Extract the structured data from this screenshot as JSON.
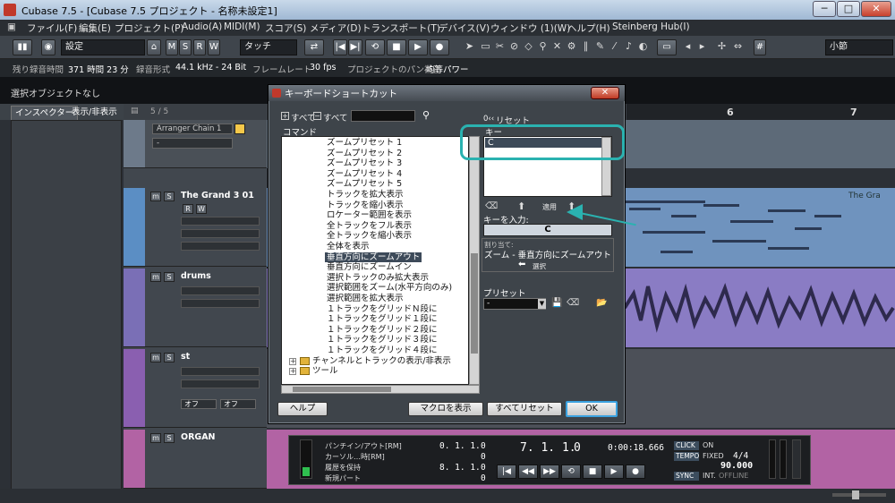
{
  "window": {
    "title": "Cubase 7.5 - [Cubase 7.5 プロジェクト - 名称未設定1]",
    "min_label": "─",
    "max_label": "□",
    "close_label": "✕"
  },
  "menu": {
    "items": [
      "ファイル(F)",
      "編集(E)",
      "プロジェクト(P)",
      "Audio(A)",
      "MIDI(M)",
      "スコア(S)",
      "メディア(D)",
      "トランスポート(T)",
      "デバイス(V)",
      "ウィンドウ (1)(W)",
      "ヘルプ(H)",
      "Steinberg Hub(I)"
    ]
  },
  "toolbar": {
    "preset": "設定",
    "m": "M",
    "s": "S",
    "r": "R",
    "w": "W",
    "mode": "タッチ",
    "snap": "小節"
  },
  "infoline": {
    "rec_time_label": "残り録音時間",
    "rec_time_value": "371 時間 23 分",
    "format_label": "録音形式",
    "format_value": "44.1 kHz - 24 Bit",
    "framerate_label": "フレームレート",
    "framerate_value": "30 fps",
    "pan_label": "プロジェクトのパン補正",
    "pan_value": "均等パワー"
  },
  "selection_line": "選択オブジェクトなし",
  "inspector": {
    "tab_inspector": "インスペクター",
    "tab_view": "表示/非表示",
    "track_count": "5 / 5"
  },
  "tracks": [
    {
      "name": "Arranger Chain 1",
      "extra": "-"
    },
    {
      "name": "The Grand 3 01",
      "clip": "The Gra"
    },
    {
      "name": "drums"
    },
    {
      "name": "st",
      "off1": "オフ",
      "off2": "オフ"
    },
    {
      "name": "ORGAN"
    }
  ],
  "ruler": {
    "bar6": "6",
    "bar7": "7"
  },
  "dialog": {
    "title": "キーボードショートカット",
    "close": "✕",
    "expand_all": "すべて",
    "collapse_all": "すべて",
    "command_header": "コマンド",
    "reset_label": "リセット",
    "key_header": "キー",
    "key_value": "C",
    "apply_label": "適用",
    "key_input_label": "キーを入力:",
    "key_input_value": "C",
    "assigned_to_label": "割り当て:",
    "assigned_to_value": "ズーム - 垂直方向にズームアウト",
    "select_label": "選択",
    "preset_label": "プリセット",
    "preset_value": "-",
    "help_button": "ヘルプ",
    "show_macros_button": "マクロを表示",
    "reset_all_button": "すべてリセット",
    "ok_button": "OK",
    "commands": [
      "ズームプリセット 1",
      "ズームプリセット 2",
      "ズームプリセット 3",
      "ズームプリセット 4",
      "ズームプリセット 5",
      "トラックを拡大表示",
      "トラックを縮小表示",
      "ロケーター範囲を表示",
      "全トラックをフル表示",
      "全トラックを縮小表示",
      "全体を表示",
      "垂直方向にズームアウト",
      "垂直方向にズームイン",
      "選択トラックのみ拡大表示",
      "選択範囲をズーム(水平方向のみ)",
      "選択範囲を拡大表示",
      "１トラックをグリッドＮ段に",
      "１トラックをグリッド１段に",
      "１トラックをグリッド２段に",
      "１トラックをグリッド３段に",
      "１トラックをグリッド４段に"
    ],
    "selected_index": 11,
    "folders": [
      "チャンネルとトラックの表示/非表示",
      "ツール"
    ]
  },
  "transport": {
    "punch_label": "パンチイン/アウト[RM]",
    "cursor_label": "カーソル…時[RM]",
    "keep_history": "履歴を保持",
    "new_part": "新規パート",
    "locator_left": "0. 1. 1.",
    "locator_left_tail": "0",
    "locator_zero": "0",
    "locator_right": "8. 1. 1.",
    "locator_right_tail": "0",
    "locator_zero2": "0",
    "position_bars": "7. 1. 1.",
    "position_tail": "0",
    "position_time": "0:00:18.666",
    "click_label": "CLICK",
    "click_value": "ON",
    "tempo_label": "TEMPO",
    "tempo_mode": "FIXED",
    "signature": "4/4",
    "tempo_value": "90.000",
    "sync_label": "SYNC",
    "sync_source": "INT.",
    "sync_status": "OFFLINE"
  },
  "colors": {
    "highlight": "#2ab2b0",
    "track_blue": "#5b8ec4",
    "track_purple": "#7a6fb6",
    "track_pink": "#b263a4"
  }
}
